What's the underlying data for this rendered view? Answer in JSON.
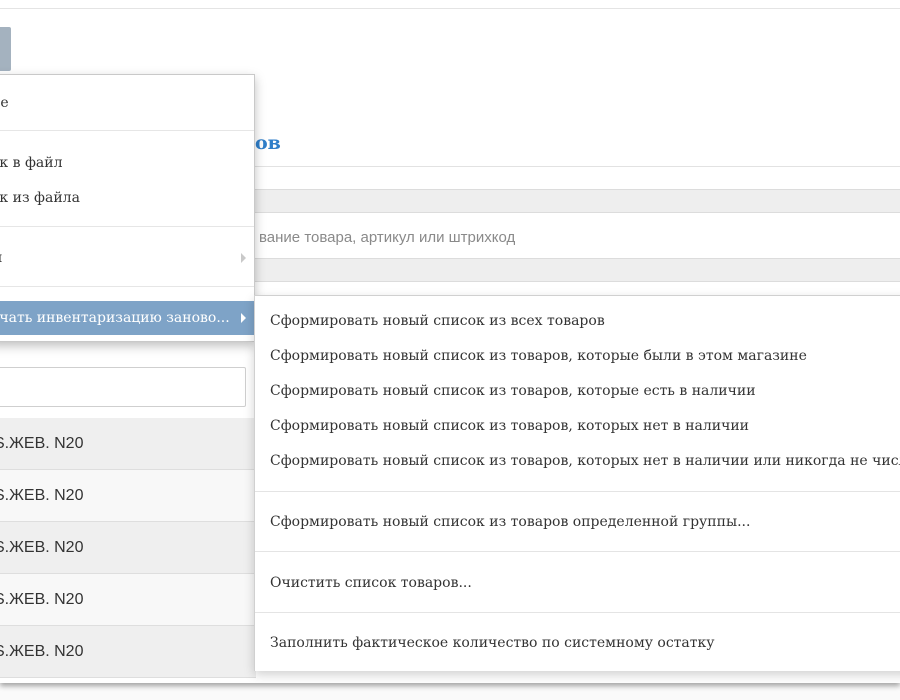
{
  "page": {
    "title": "ов",
    "search_placeholder": "вание товара, артикул или штрихкод"
  },
  "main_menu": {
    "items": [
      {
        "label": "не"
      },
      {
        "label": "ок в файл"
      },
      {
        "label": "ок из файла"
      },
      {
        "label": "ы"
      },
      {
        "label": "ачать инвентаризацию заново..."
      }
    ]
  },
  "sub_menu": {
    "items": [
      {
        "label": "Сформировать новый список из всех товаров"
      },
      {
        "label": "Сформировать новый список из товаров, которые были в этом магазине"
      },
      {
        "label": "Сформировать новый список из товаров, которые есть в наличии"
      },
      {
        "label": "Сформировать новый список из товаров, которых нет в наличии"
      },
      {
        "label": "Сформировать новый список из товаров, которых нет в наличии или никогда не числил"
      },
      {
        "label": "Сформировать новый список из товаров определенной группы..."
      },
      {
        "label": "Очистить список товаров..."
      },
      {
        "label": "Заполнить фактическое количество по системному остатку"
      }
    ]
  },
  "list": {
    "rows": [
      {
        "name": "S.ЖЕВ. N20"
      },
      {
        "name": "S.ЖЕВ. N20"
      },
      {
        "name": "S.ЖЕВ. N20"
      },
      {
        "name": "S.ЖЕВ. N20"
      },
      {
        "name": "S.ЖЕВ. N20"
      }
    ]
  },
  "colors": {
    "accent_title": "#2f7ec9",
    "menu_highlight": "#7ea3c7"
  }
}
